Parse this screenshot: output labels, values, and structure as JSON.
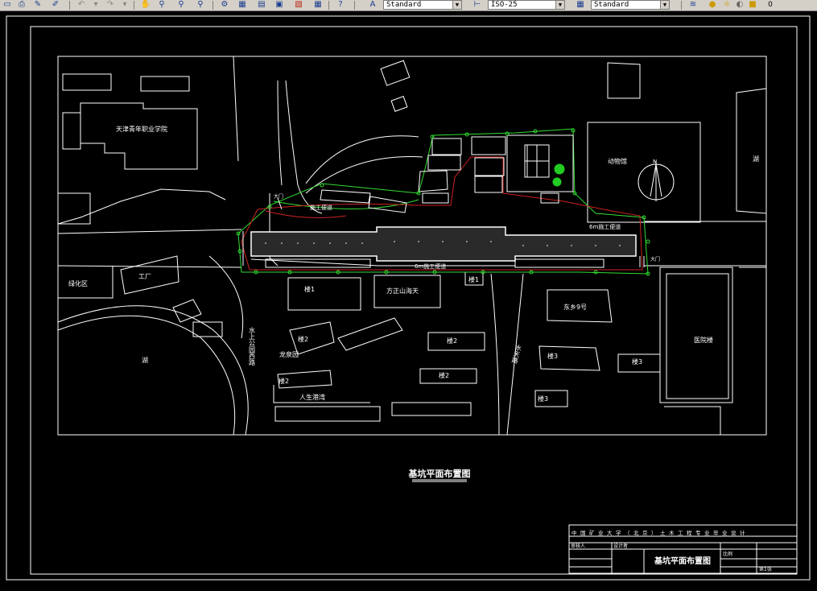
{
  "toolbar": {
    "text_style": "Standard",
    "dim_style": "ISO-25",
    "table_style": "Standard",
    "layer_value": "0"
  },
  "drawing": {
    "title": "基坑平面布置图",
    "labels": {
      "school": "天津青年职业学院",
      "zoo": "动物馆",
      "lake_right": "湖",
      "lake_left": "湖",
      "greenhouse": "绿化区",
      "factory": "工厂",
      "lake_center": "湖",
      "road_left": "水上公园西路",
      "road_mid": "水天路",
      "bldg1": "楼1",
      "bldg_fangzheng": "方正山海天",
      "bldg_building1": "楼1",
      "bldg_dongxiang": "东乡9号",
      "bldg_hospital": "医院楼",
      "bldg_longquan": "龙泉园",
      "bldg_rensheng": "人生港湾",
      "bldg2a": "楼2",
      "bldg2b": "楼2",
      "bldg2c": "楼2",
      "bldg2d": "楼2",
      "bldg3a": "楼3",
      "bldg3b": "楼3",
      "bldg3c": "楼3",
      "gate_left": "大门",
      "gate_right": "大门",
      "road_top": "施工便道",
      "road_bottom": "6m施工便道",
      "road_right": "6m施工便道",
      "north_label": "N"
    },
    "title_block": {
      "header": "中国矿业大学（北京）土木工程专业毕业设计",
      "reviewer": "审核人",
      "designer": "设计者",
      "drawing_name": "基坑平面布置图",
      "scale": "比例",
      "sheet": "第1张"
    }
  }
}
